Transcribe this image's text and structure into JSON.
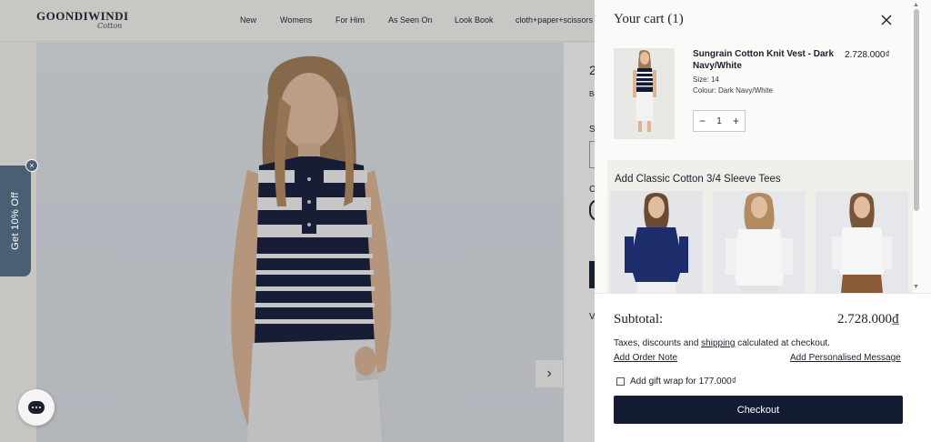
{
  "colors": {
    "navy": "#141c33",
    "promo": "#4b5f74",
    "overlay": "rgba(40,40,40,0.22)",
    "drawer_bg": "#fafaf8",
    "upsell_bg": "#f0efea"
  },
  "header": {
    "logo_main": "GOONDIWINDI",
    "logo_sub": "Cotton",
    "nav": [
      "New",
      "Womens",
      "For Him",
      "As Seen On",
      "Look Book",
      "cloth+paper+scissors"
    ]
  },
  "page": {
    "fragments": [
      "2",
      "Be",
      "S",
      "C",
      "V"
    ]
  },
  "icons": {
    "next": "chevron-right-icon",
    "close": "close-icon",
    "chat": "chat-bubble-icon"
  },
  "promo": {
    "label": "Get 10% Off",
    "close": "×"
  },
  "cart": {
    "title": "Your cart (1)",
    "item": {
      "name": "Sungrain Cotton Knit Vest - Dark Navy/White",
      "price": "2.728.000₫",
      "size": "Size: 14",
      "colour": "Colour: Dark Navy/White",
      "quantity": "1",
      "minus": "−",
      "plus": "+"
    },
    "upsell_title": "Add Classic Cotton 3/4 Sleeve Tees",
    "upsell_items": [
      "navy-tee",
      "white-tee",
      "white-tee-2"
    ]
  },
  "footer": {
    "subtotal_label": "Subtotal:",
    "subtotal_value": "2.728.000₫",
    "tax_before": "Taxes, discounts and ",
    "tax_link": "shipping",
    "tax_after": " calculated at checkout.",
    "order_note": "Add Order Note",
    "personalised": "Add Personalised Message",
    "gift_wrap": "Add gift wrap for 177.000₫",
    "checkout": "Checkout"
  }
}
